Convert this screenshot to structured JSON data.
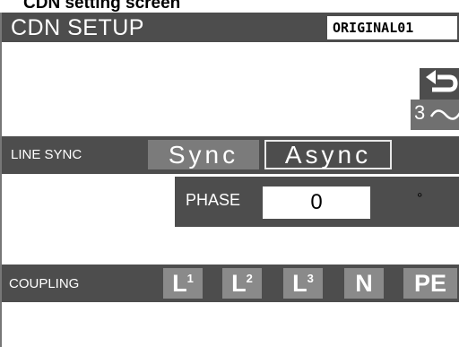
{
  "caption": "CDN setting screen",
  "header": {
    "title": "CDN SETUP",
    "program": "ORIGINAL01"
  },
  "icons": {
    "return": "return-icon",
    "phase": "sine-wave-icon"
  },
  "phase_button": {
    "label": "3"
  },
  "line_sync": {
    "label": "LINE SYNC",
    "sync": "Sync",
    "async": "Async"
  },
  "phase": {
    "label": "PHASE",
    "value": "0",
    "unit": "°"
  },
  "coupling": {
    "label": "COUPLING",
    "buttons": [
      {
        "main": "L",
        "sub": "1"
      },
      {
        "main": "L",
        "sub": "2"
      },
      {
        "main": "L",
        "sub": "3"
      },
      {
        "main": "N",
        "sub": ""
      },
      {
        "main": "PE",
        "sub": ""
      }
    ]
  }
}
